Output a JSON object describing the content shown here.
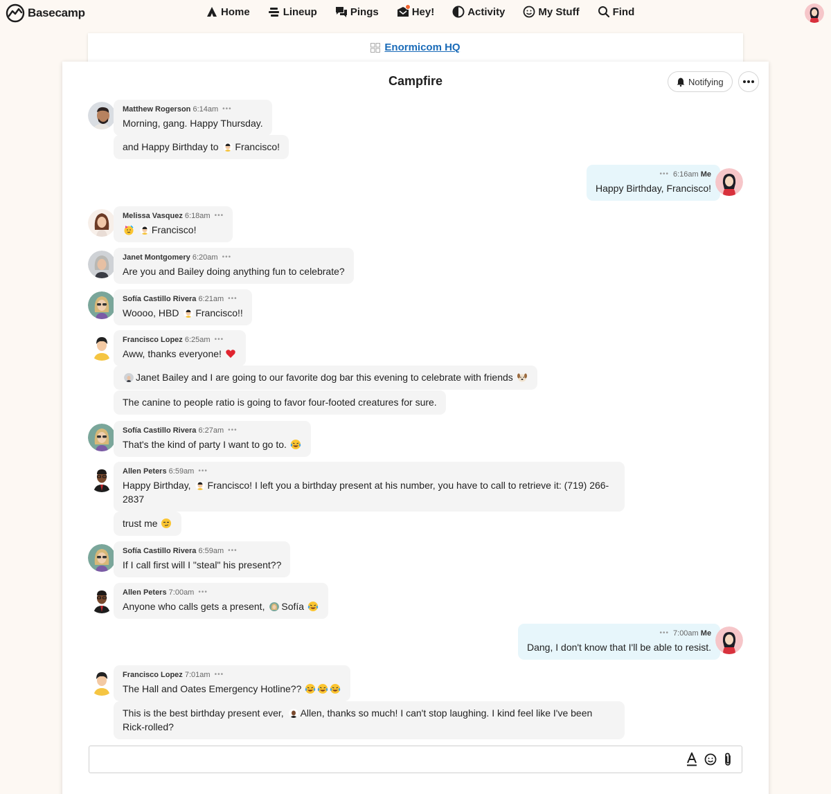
{
  "brand": {
    "name": "Basecamp"
  },
  "nav": [
    {
      "label": "Home",
      "icon": "home-icon"
    },
    {
      "label": "Lineup",
      "icon": "lineup-icon"
    },
    {
      "label": "Pings",
      "icon": "pings-icon"
    },
    {
      "label": "Hey!",
      "icon": "hey-icon"
    },
    {
      "label": "Activity",
      "icon": "activity-icon"
    },
    {
      "label": "My Stuff",
      "icon": "my-stuff-icon"
    },
    {
      "label": "Find",
      "icon": "find-icon"
    }
  ],
  "project": {
    "name": "Enormicom HQ"
  },
  "campfire": {
    "title": "Campfire",
    "notify_label": "Notifying"
  },
  "colors": {
    "accent_link": "#1a6bb8",
    "hey_badge": "#f0632d",
    "my_bubble": "#e7f6fb",
    "other_bubble": "#f4f4f4"
  },
  "messages": [
    {
      "author": "Matthew Rogerson",
      "time": "6:14am",
      "text": "Morning, gang.  Happy Thursday."
    },
    {
      "text_before": "and Happy Birthday to",
      "mention": "Francisco!"
    },
    {
      "author": "Me",
      "time": "6:16am",
      "text": "Happy Birthday, Francisco!"
    },
    {
      "author": "Melissa Vasquez",
      "time": "6:18am",
      "mention": "Francisco!"
    },
    {
      "author": "Janet Montgomery",
      "time": "6:20am",
      "text": "Are you and Bailey doing anything fun to celebrate?"
    },
    {
      "author": "Sofía Castillo Rivera",
      "time": "6:21am",
      "text_before": "Woooo, HBD",
      "mention": "Francisco!!"
    },
    {
      "author": "Francisco Lopez",
      "time": "6:25am",
      "text": "Aww, thanks everyone!"
    },
    {
      "mention": "Janet",
      "text_after": "Bailey and I are going to our favorite dog bar this evening to celebrate with friends"
    },
    {
      "text": "The canine to people ratio is going to favor four-footed creatures for sure."
    },
    {
      "author": "Sofía Castillo Rivera",
      "time": "6:27am",
      "text": "That's the kind of party I want to go to."
    },
    {
      "author": "Allen Peters",
      "time": "6:59am",
      "text_before": "Happy Birthday,",
      "mention": "Francisco!",
      "text_after": "I left you a birthday present at his number, you have to call to retrieve it: (719) 266-2837"
    },
    {
      "text": "trust me"
    },
    {
      "author": "Sofía Castillo Rivera",
      "time": "6:59am",
      "text": "If I call first will I \"steal\" his present??"
    },
    {
      "author": "Allen Peters",
      "time": "7:00am",
      "text_before": "Anyone who calls gets a present,",
      "mention": "Sofía"
    },
    {
      "author": "Me",
      "time": "7:00am",
      "text": "Dang, I don't know that I'll be able to resist."
    },
    {
      "author": "Francisco Lopez",
      "time": "7:01am",
      "text": "The Hall and Oates Emergency Hotline??"
    },
    {
      "text_before": "This is the best birthday present ever,",
      "mention": "Allen,",
      "text_after": "thanks so much! I can't stop laughing. I kind feel like I've been Rick-rolled?"
    }
  ],
  "composer": {
    "placeholder": ""
  },
  "more_dots": "•••"
}
